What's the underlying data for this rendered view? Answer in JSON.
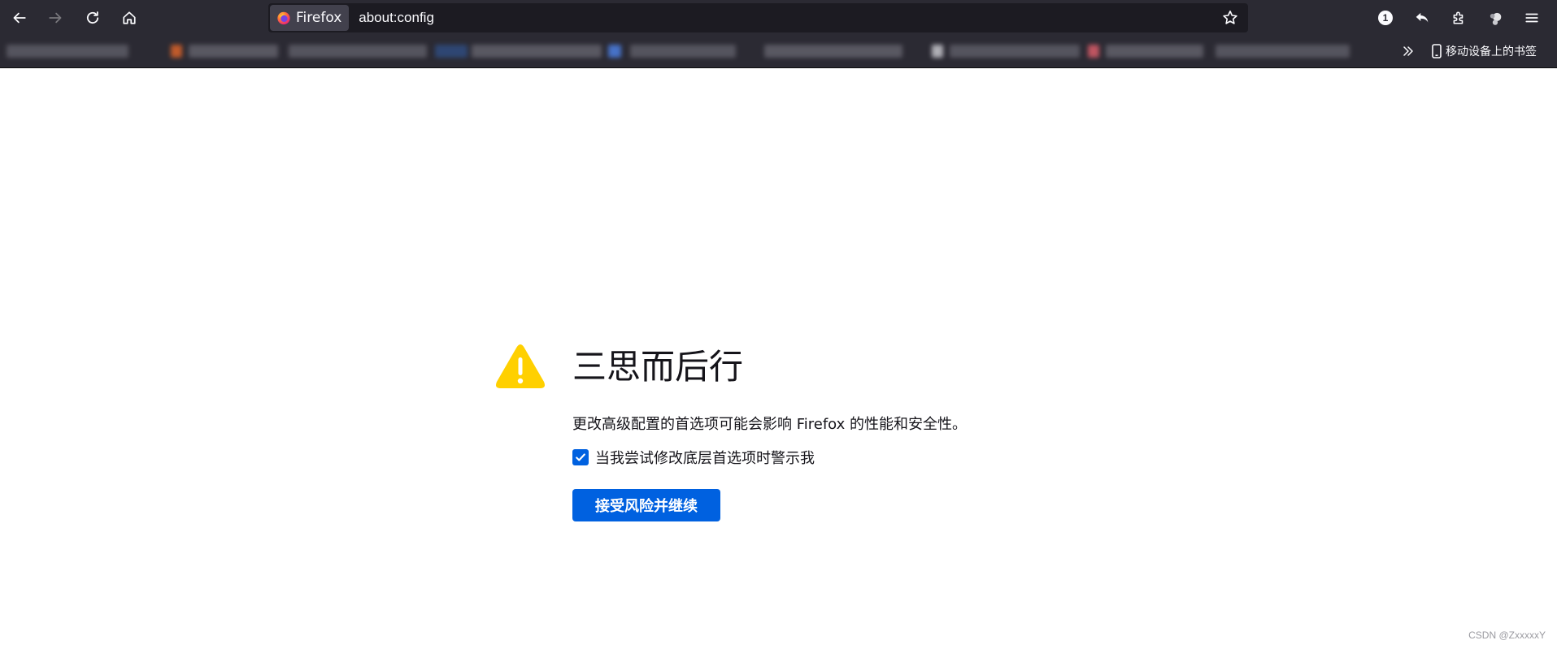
{
  "toolbar": {
    "back_icon": "arrow-left-icon",
    "forward_icon": "arrow-right-icon",
    "reload_icon": "reload-icon",
    "home_icon": "home-icon",
    "identity_label": "Firefox",
    "url": "about:config",
    "extension_badge": "1"
  },
  "bookmarks": {
    "mobile_label": "移动设备上的书签"
  },
  "warning": {
    "title": "三思而后行",
    "description": "更改高级配置的首选项可能会影响 Firefox 的性能和安全性。",
    "checkbox_label": "当我尝试修改底层首选项时警示我",
    "checkbox_checked": true,
    "accept_label": "接受风险并继续"
  },
  "watermark": "CSDN @ZxxxxxY",
  "colors": {
    "toolbar_bg": "#2b2a33",
    "urlbar_bg": "#1c1b22",
    "accent": "#0061e0",
    "warning_yellow": "#ffd000"
  }
}
